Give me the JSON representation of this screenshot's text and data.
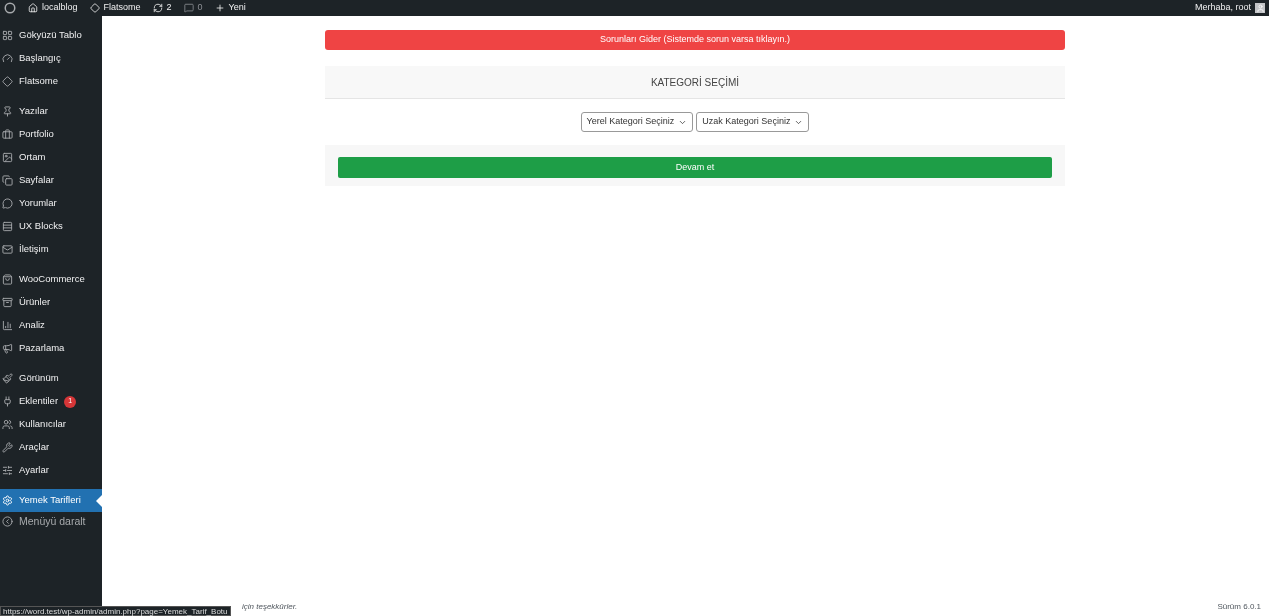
{
  "admin_bar": {
    "site": "localblog",
    "theme": "Flatsome",
    "updates": "2",
    "comments": "0",
    "new": "Yeni",
    "greeting": "Merhaba, root"
  },
  "menu": {
    "groups": [
      [
        {
          "label": "Gökyüzü Tablo",
          "selected": false
        },
        {
          "label": "Başlangıç",
          "selected": false
        },
        {
          "label": "Flatsome",
          "selected": false
        }
      ],
      [
        {
          "label": "Yazılar",
          "selected": false
        },
        {
          "label": "Portfolio",
          "selected": false
        },
        {
          "label": "Ortam",
          "selected": false
        },
        {
          "label": "Sayfalar",
          "selected": false
        },
        {
          "label": "Yorumlar",
          "selected": false
        },
        {
          "label": "UX Blocks",
          "selected": false
        },
        {
          "label": "İletişim",
          "selected": false
        }
      ],
      [
        {
          "label": "WooCommerce",
          "selected": false
        },
        {
          "label": "Ürünler",
          "selected": false
        },
        {
          "label": "Analiz",
          "selected": false
        },
        {
          "label": "Pazarlama",
          "selected": false
        }
      ],
      [
        {
          "label": "Görünüm",
          "selected": false
        },
        {
          "label": "Eklentiler",
          "selected": false,
          "badge": "1"
        },
        {
          "label": "Kullanıcılar",
          "selected": false
        },
        {
          "label": "Araçlar",
          "selected": false
        },
        {
          "label": "Ayarlar",
          "selected": false
        }
      ],
      [
        {
          "label": "Yemek Tarifleri",
          "selected": true
        }
      ]
    ],
    "collapse": "Menüyü daralt"
  },
  "troubleshoot_button": "Sorunları Gider (Sistemde sorun varsa tıklayın.)",
  "panel": {
    "title": "KATEGORİ SEÇİMİ",
    "selects": [
      "Yerel Kategori Seçiniz",
      "Uzak Kategori Seçiniz"
    ],
    "continue_button": "Devam et"
  },
  "footer": {
    "thanks": "için teşekkürler.",
    "version": "Sürüm 6.0.1"
  },
  "status_url": "https://word.test/wp-admin/admin.php?page=Yemek_Tarif_Botu"
}
